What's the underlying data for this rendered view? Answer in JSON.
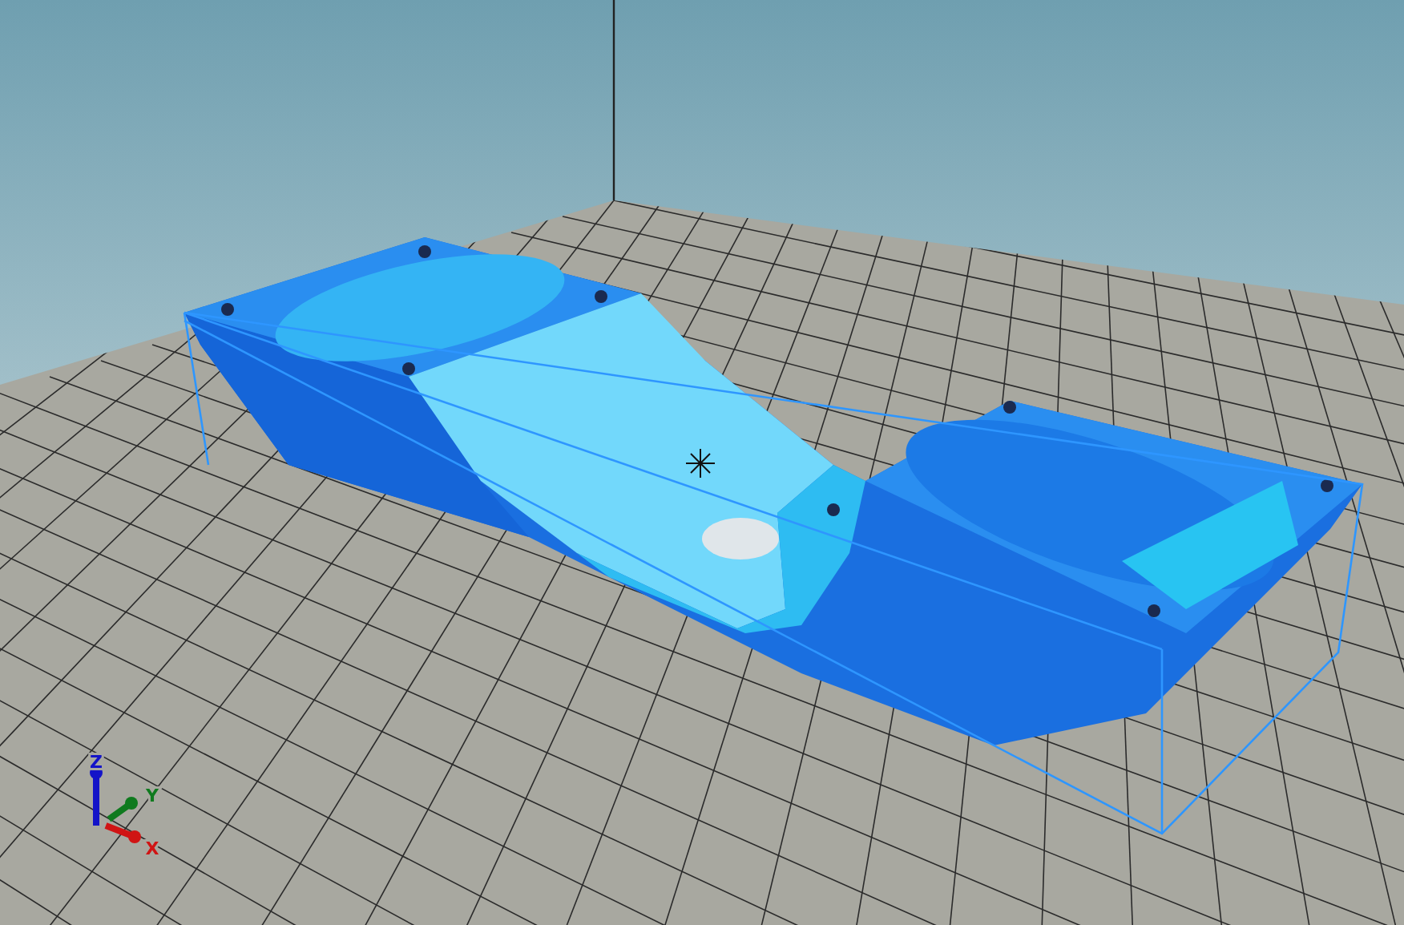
{
  "axes": [
    {
      "label": "Z",
      "color": "#1414c8"
    },
    {
      "label": "Y",
      "color": "#0f7a1e"
    },
    {
      "label": "X",
      "color": "#d01414"
    }
  ]
}
